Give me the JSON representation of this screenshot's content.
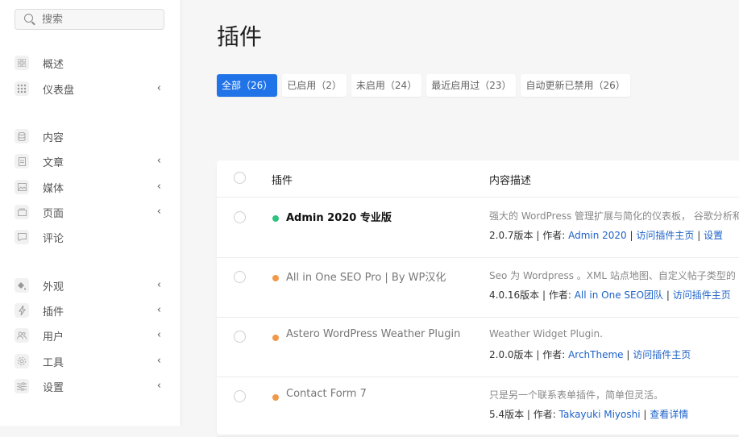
{
  "search": {
    "placeholder": "搜索"
  },
  "sidebar": {
    "items": [
      {
        "label": "概述",
        "icon": "grid-icon",
        "chevron": false
      },
      {
        "label": "仪表盘",
        "icon": "dots-grid-icon",
        "chevron": true
      },
      {
        "label": "内容",
        "icon": "database-icon",
        "chevron": false
      },
      {
        "label": "文章",
        "icon": "document-icon",
        "chevron": true
      },
      {
        "label": "媒体",
        "icon": "image-icon",
        "chevron": true
      },
      {
        "label": "页面",
        "icon": "pages-icon",
        "chevron": true
      },
      {
        "label": "评论",
        "icon": "comment-icon",
        "chevron": false
      },
      {
        "label": "外观",
        "icon": "paint-bucket-icon",
        "chevron": true
      },
      {
        "label": "插件",
        "icon": "plug-icon",
        "chevron": true
      },
      {
        "label": "用户",
        "icon": "users-icon",
        "chevron": true
      },
      {
        "label": "工具",
        "icon": "gear-icon",
        "chevron": true
      },
      {
        "label": "设置",
        "icon": "sliders-icon",
        "chevron": true
      }
    ]
  },
  "page": {
    "title": "插件"
  },
  "tabs": [
    {
      "label": "全部（26）",
      "active": true
    },
    {
      "label": "已启用（2）",
      "active": false
    },
    {
      "label": "未启用（24）",
      "active": false
    },
    {
      "label": "最近启用过（23）",
      "active": false
    },
    {
      "label": "自动更新已禁用（26）",
      "active": false
    }
  ],
  "table": {
    "headers": {
      "plugin": "插件",
      "description": "内容描述"
    },
    "rows": [
      {
        "name": "Admin 2020 专业版",
        "status_color": "#2ec27e",
        "active": true,
        "description": "强大的 WordPress 管理扩展与简化的仪表板， 谷歌分析和 W",
        "version": "2.0.7版本 | 作者:",
        "author": "Admin 2020",
        "sep1": "|",
        "link1": "访问插件主页",
        "sep2": "|",
        "link2": "设置"
      },
      {
        "name": "All in One SEO Pro | By WP汉化",
        "status_color": "#f0994b",
        "active": false,
        "description": "Seo 为 Wordpress 。XML 站点地图、自定义帖子类型的 SEC",
        "version": "4.0.16版本 | 作者:",
        "author": "All in One SEO团队",
        "sep1": "|",
        "link1": "访问插件主页",
        "sep2": "",
        "link2": ""
      },
      {
        "name": "Astero WordPress Weather Plugin",
        "status_color": "#f0994b",
        "active": false,
        "description": "Weather Widget Plugin.",
        "version": "2.0.0版本 | 作者:",
        "author": "ArchTheme",
        "sep1": "|",
        "link1": "访问插件主页",
        "sep2": "",
        "link2": ""
      },
      {
        "name": "Contact Form 7",
        "status_color": "#f0994b",
        "active": false,
        "description": "只是另一个联系表单插件，简单但灵活。",
        "version": "5.4版本 | 作者:",
        "author": "Takayuki Miyoshi",
        "sep1": "|",
        "link1": "查看详情",
        "sep2": "",
        "link2": ""
      }
    ]
  },
  "colors": {
    "accent": "#2174e8",
    "link": "#1d62c8",
    "active_dot": "#2ec27e",
    "inactive_dot": "#f0994b"
  }
}
